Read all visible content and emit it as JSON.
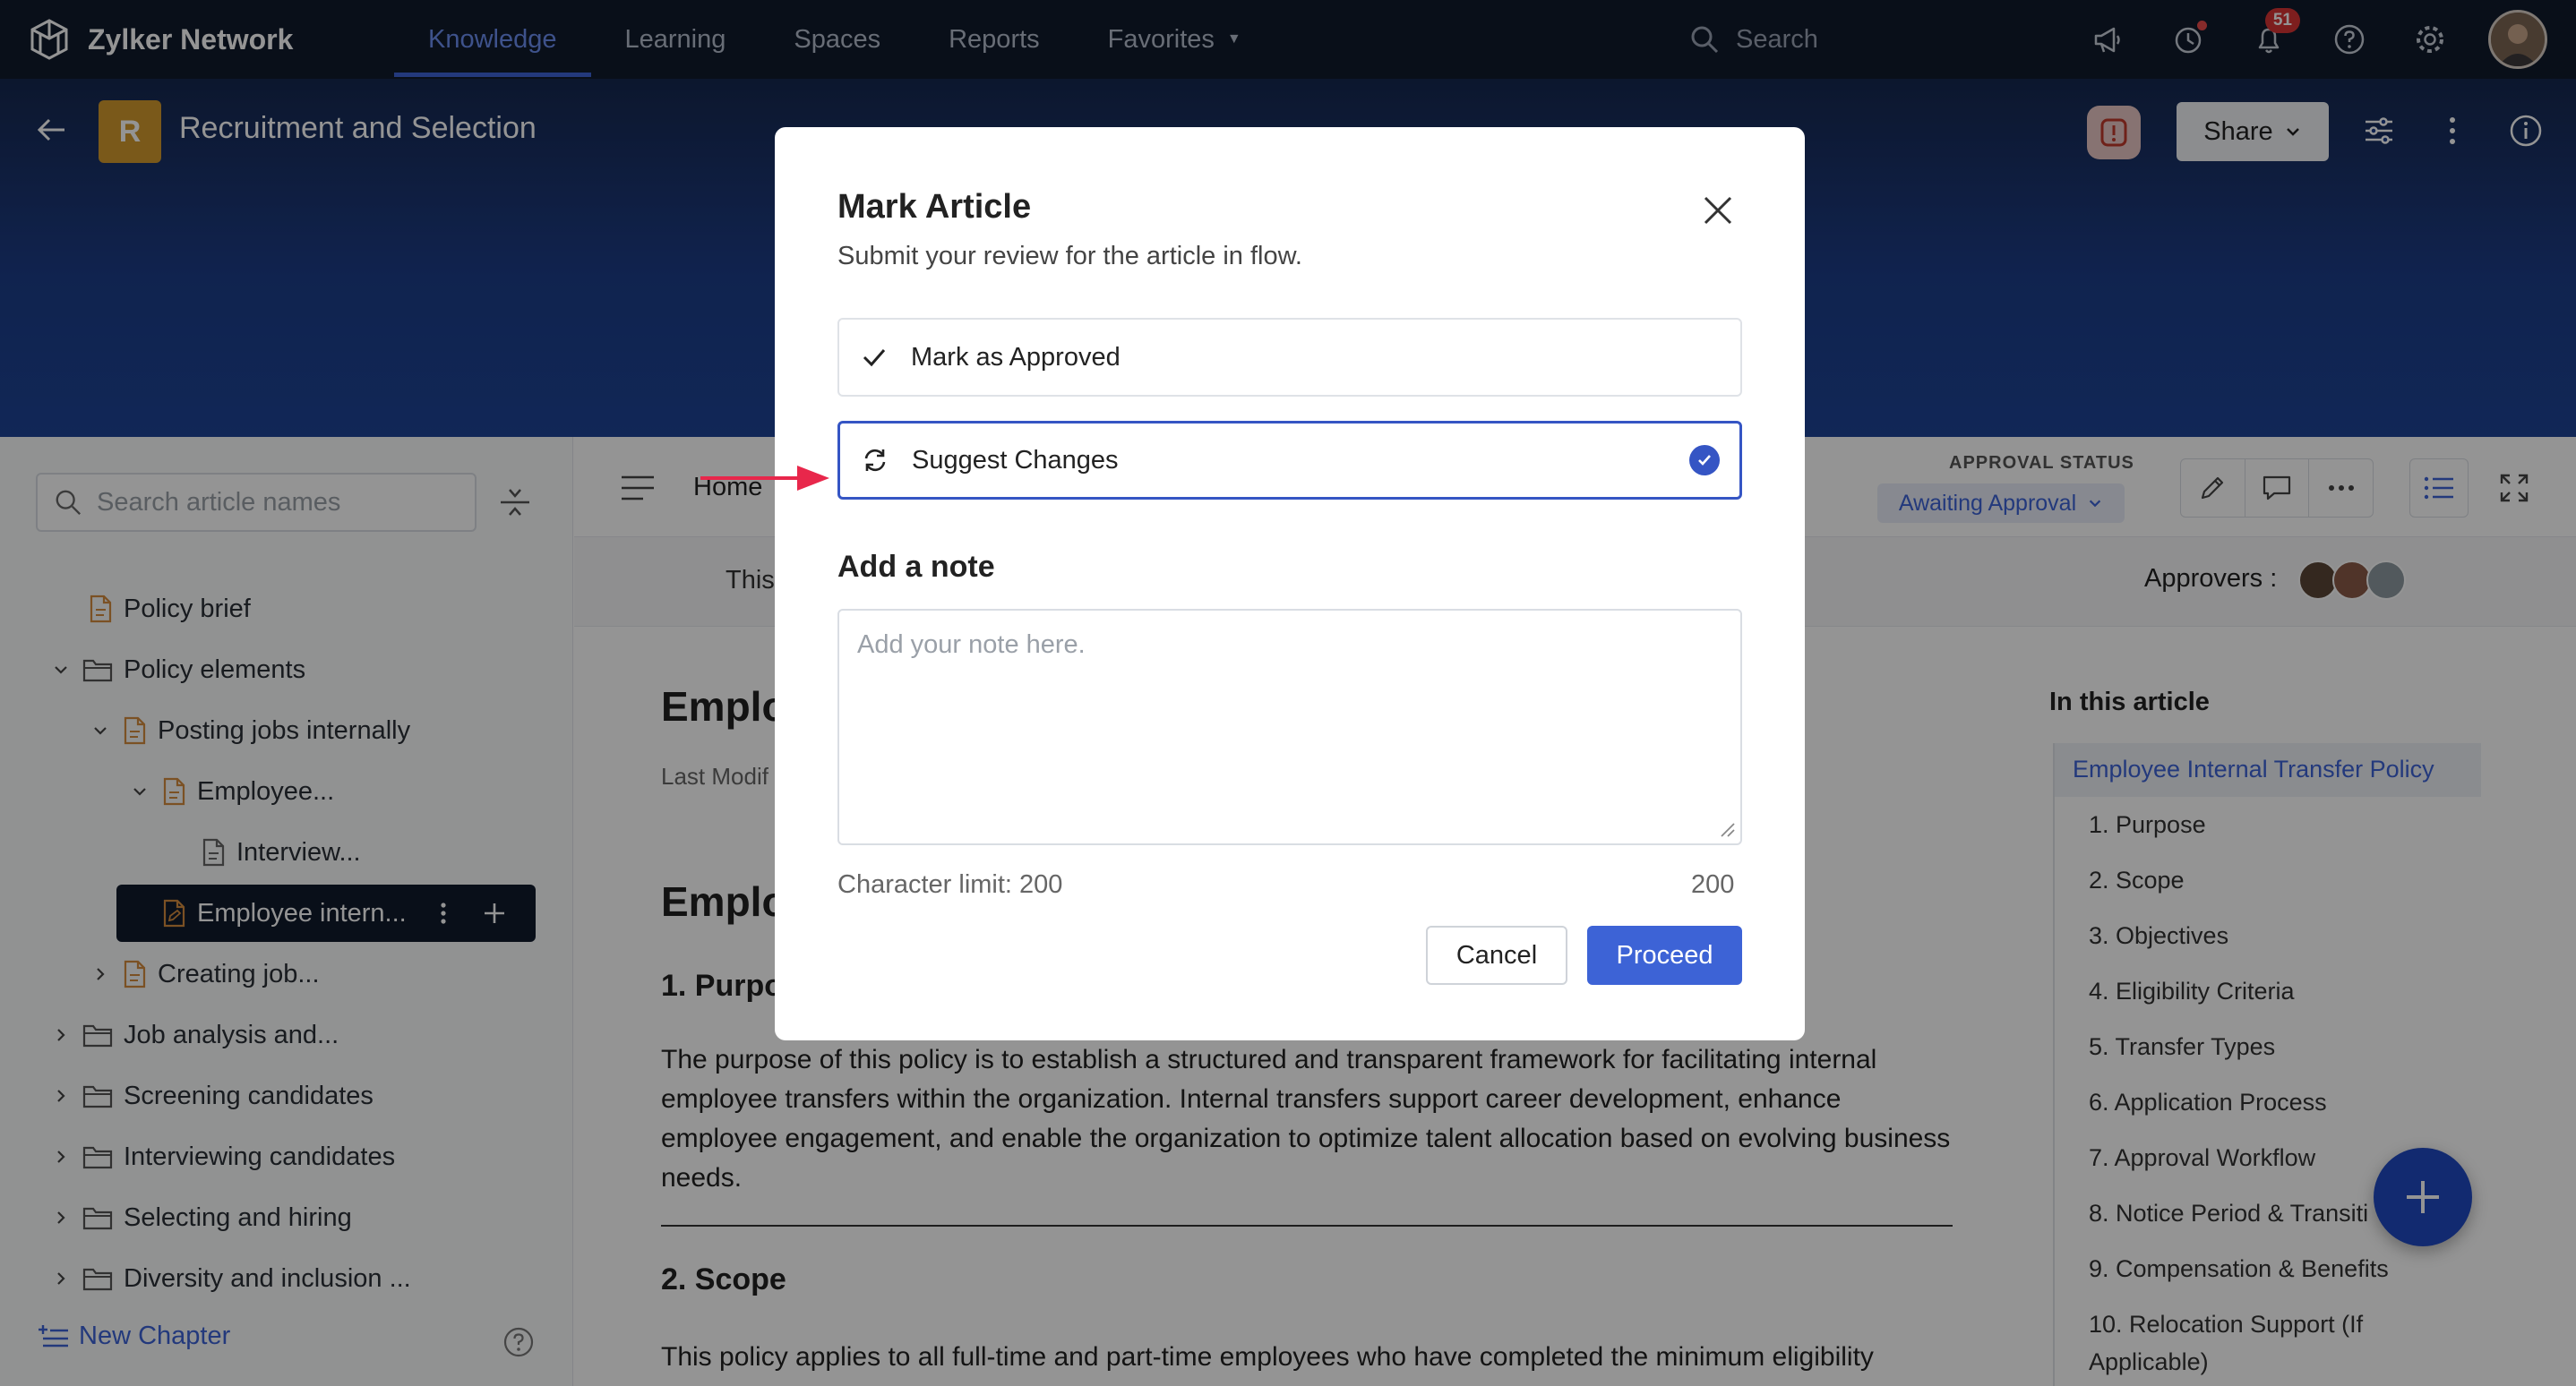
{
  "app": {
    "name": "Zylker Network"
  },
  "topnav": {
    "tabs": [
      "Knowledge",
      "Learning",
      "Spaces",
      "Reports",
      "Favorites"
    ],
    "search_placeholder": "Search",
    "notification_count": "51"
  },
  "space": {
    "badge": "R",
    "title": "Recruitment and Selection",
    "share_label": "Share"
  },
  "sidebar": {
    "search_placeholder": "Search article names",
    "items": [
      {
        "label": "Policy brief"
      },
      {
        "label": "Policy elements"
      },
      {
        "label": "Posting jobs internally"
      },
      {
        "label": "Employee..."
      },
      {
        "label": "Interview..."
      },
      {
        "label": "Employee intern..."
      },
      {
        "label": "Creating job..."
      },
      {
        "label": "Job analysis and..."
      },
      {
        "label": "Screening candidates"
      },
      {
        "label": "Interviewing candidates"
      },
      {
        "label": "Selecting and hiring"
      },
      {
        "label": "Diversity and inclusion ..."
      }
    ],
    "new_chapter_label": "New Chapter"
  },
  "toolbar": {
    "breadcrumb_home": "Home",
    "approval_status_label": "APPROVAL STATUS",
    "approval_status_value": "Awaiting Approval"
  },
  "subbar": {
    "text": "This",
    "approvers_label": "Approvers :"
  },
  "article": {
    "title_partial": "Emplo",
    "last_modified_partial": "Last Modif",
    "heading_partial": "Emplo",
    "section1_partial": "1. Purpo",
    "section1_body": "The purpose of this policy is to establish a structured and transparent framework for facilitating internal employee transfers within the organization. Internal transfers support career development, enhance employee engagement, and enable the organization to optimize talent allocation based on evolving business needs.",
    "section2": "2. Scope",
    "section2_body": "This policy applies to all full-time and part-time employees who have completed the minimum eligibility"
  },
  "toc": {
    "title": "In this article",
    "items": [
      "Employee Internal Transfer Policy",
      "1. Purpose",
      "2. Scope",
      "3. Objectives",
      "4. Eligibility Criteria",
      "5. Transfer Types",
      "6. Application Process",
      "7. Approval Workflow",
      "8. Notice Period & Transiti",
      "9. Compensation & Benefits",
      "10. Relocation Support (If",
      "Applicable)"
    ]
  },
  "modal": {
    "title": "Mark Article",
    "subtitle": "Submit your review for the article in flow.",
    "options": [
      {
        "label": "Mark as Approved",
        "selected": false
      },
      {
        "label": "Suggest Changes",
        "selected": true
      }
    ],
    "note_label": "Add a note",
    "note_placeholder": "Add your note here.",
    "note_value": "",
    "char_limit_text": "Character limit: 200",
    "char_remaining": "200",
    "cancel_label": "Cancel",
    "proceed_label": "Proceed"
  },
  "colors": {
    "nav_bg": "#101a2c",
    "accent": "#3d63d6",
    "banner": "#1e4496",
    "space_badge": "#d29a2e",
    "pointer_arrow": "#e8274b"
  }
}
